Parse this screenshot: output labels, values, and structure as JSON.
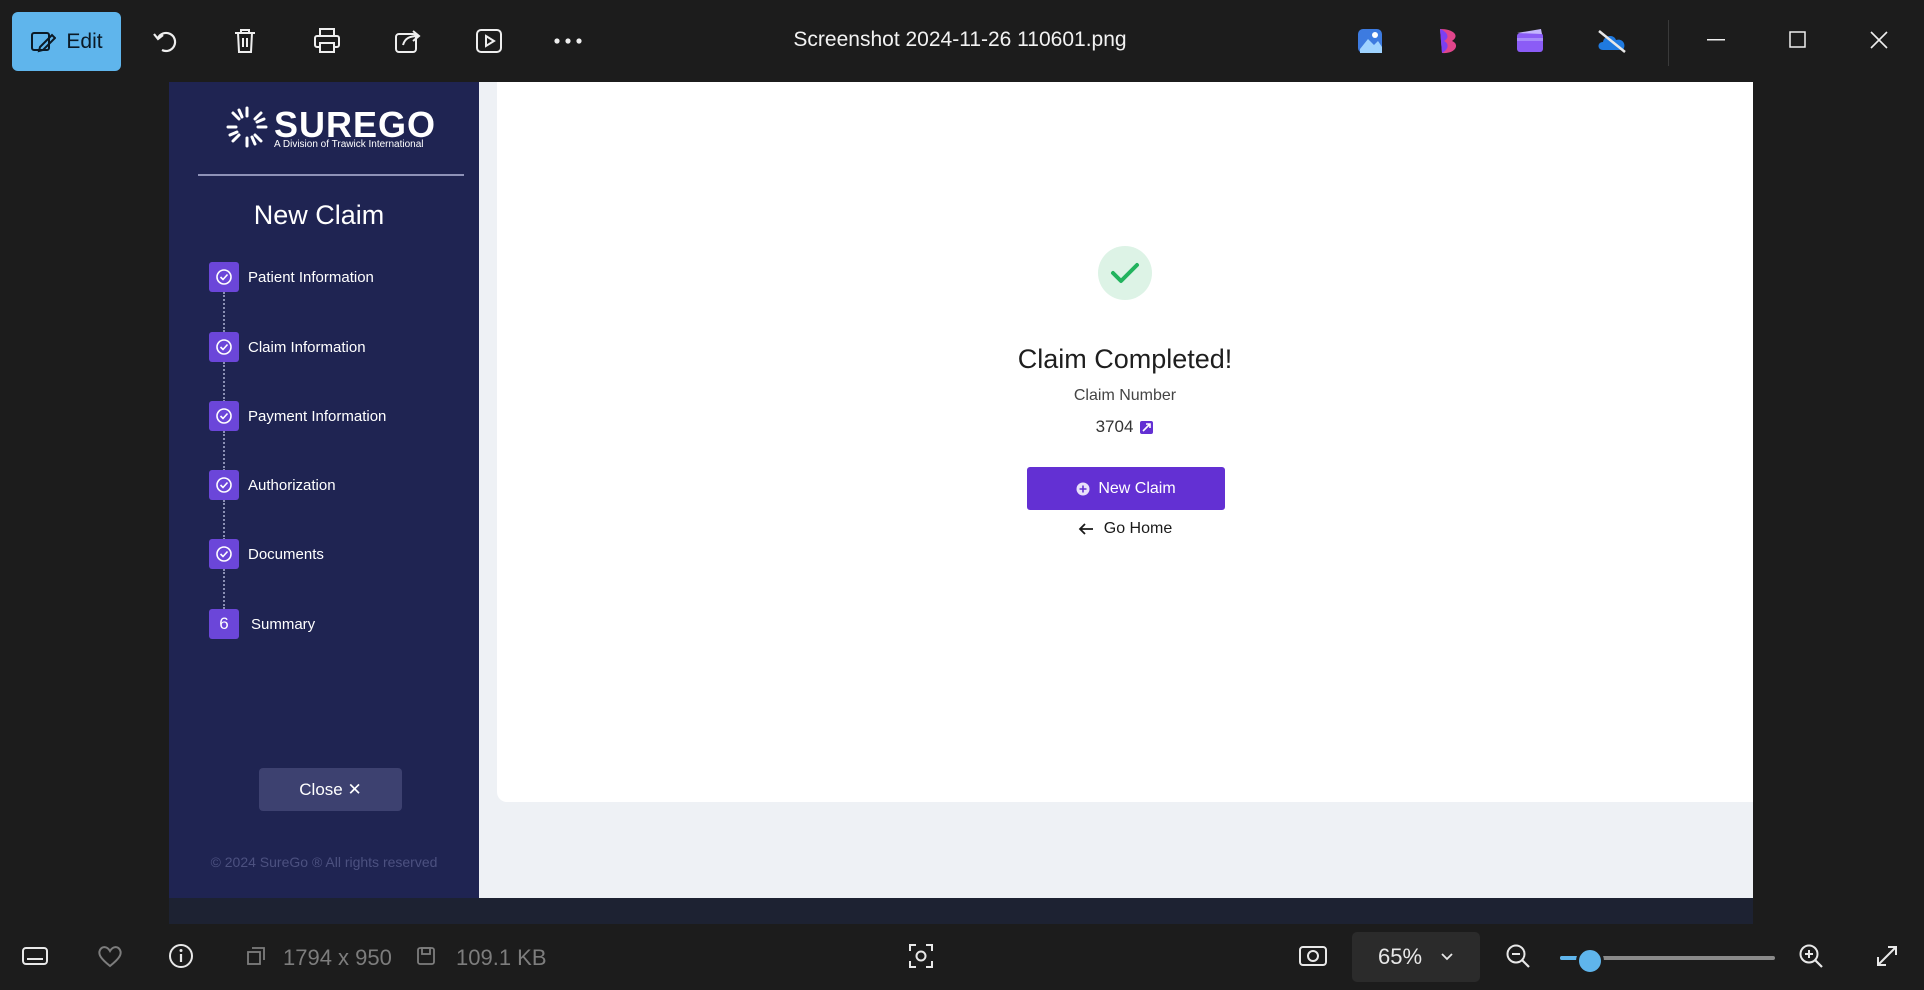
{
  "viewer": {
    "edit_label": "Edit",
    "file_title": "Screenshot 2024-11-26 110601.png",
    "dimensions": "1794 x 950",
    "file_size": "109.1 KB",
    "zoom": "65%",
    "zoom_level": 0.14,
    "accent": "#5fb5ec"
  },
  "sidebar": {
    "logo_word": "SUREGO",
    "logo_tagline": "A Division of Trawick International",
    "title": "New Claim",
    "steps": [
      {
        "label": "Patient Information",
        "state": "done"
      },
      {
        "label": "Claim Information",
        "state": "done"
      },
      {
        "label": "Payment Information",
        "state": "done"
      },
      {
        "label": "Authorization",
        "state": "done"
      },
      {
        "label": "Documents",
        "state": "done"
      },
      {
        "label": "Summary",
        "state": "current",
        "number": "6"
      }
    ],
    "close_label": "Close ✕",
    "copyright": "© 2024 SureGo ® All rights reserved",
    "bg": "#1f2452",
    "badge_color": "#6b46d9"
  },
  "result": {
    "title": "Claim Completed!",
    "claim_number_label": "Claim Number",
    "claim_number": "3704",
    "new_claim_label": "New Claim",
    "go_home_label": "Go Home",
    "button_color": "#6330d3",
    "success_color": "#22b35e"
  }
}
